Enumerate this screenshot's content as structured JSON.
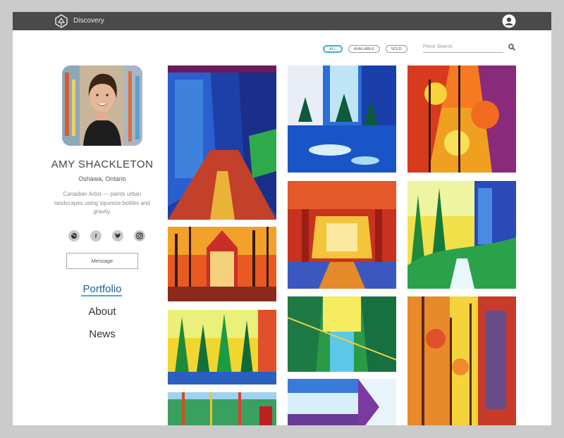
{
  "app": {
    "brand": "Discovery"
  },
  "filters": {
    "all": "ALL",
    "available": "AVAILABLE",
    "sold": "SOLD"
  },
  "search": {
    "placeholder": "Piece Search"
  },
  "profile": {
    "name": "AMY SHACKLETON",
    "location": "Oshawa, Ontario",
    "bio": "Canadian Artist — paints urban landscapes using squeeze bottles and gravity."
  },
  "social": {
    "web": "web-icon",
    "facebook": "f",
    "twitter": "twitter-icon",
    "instagram": "instagram-icon"
  },
  "message_button": "Message",
  "nav": {
    "portfolio": "Portfolio",
    "about": "About",
    "news": "News"
  },
  "colors": {
    "topbar": "#4b4a48",
    "accent": "#34b4d4",
    "active_nav": "#1f5f93"
  }
}
